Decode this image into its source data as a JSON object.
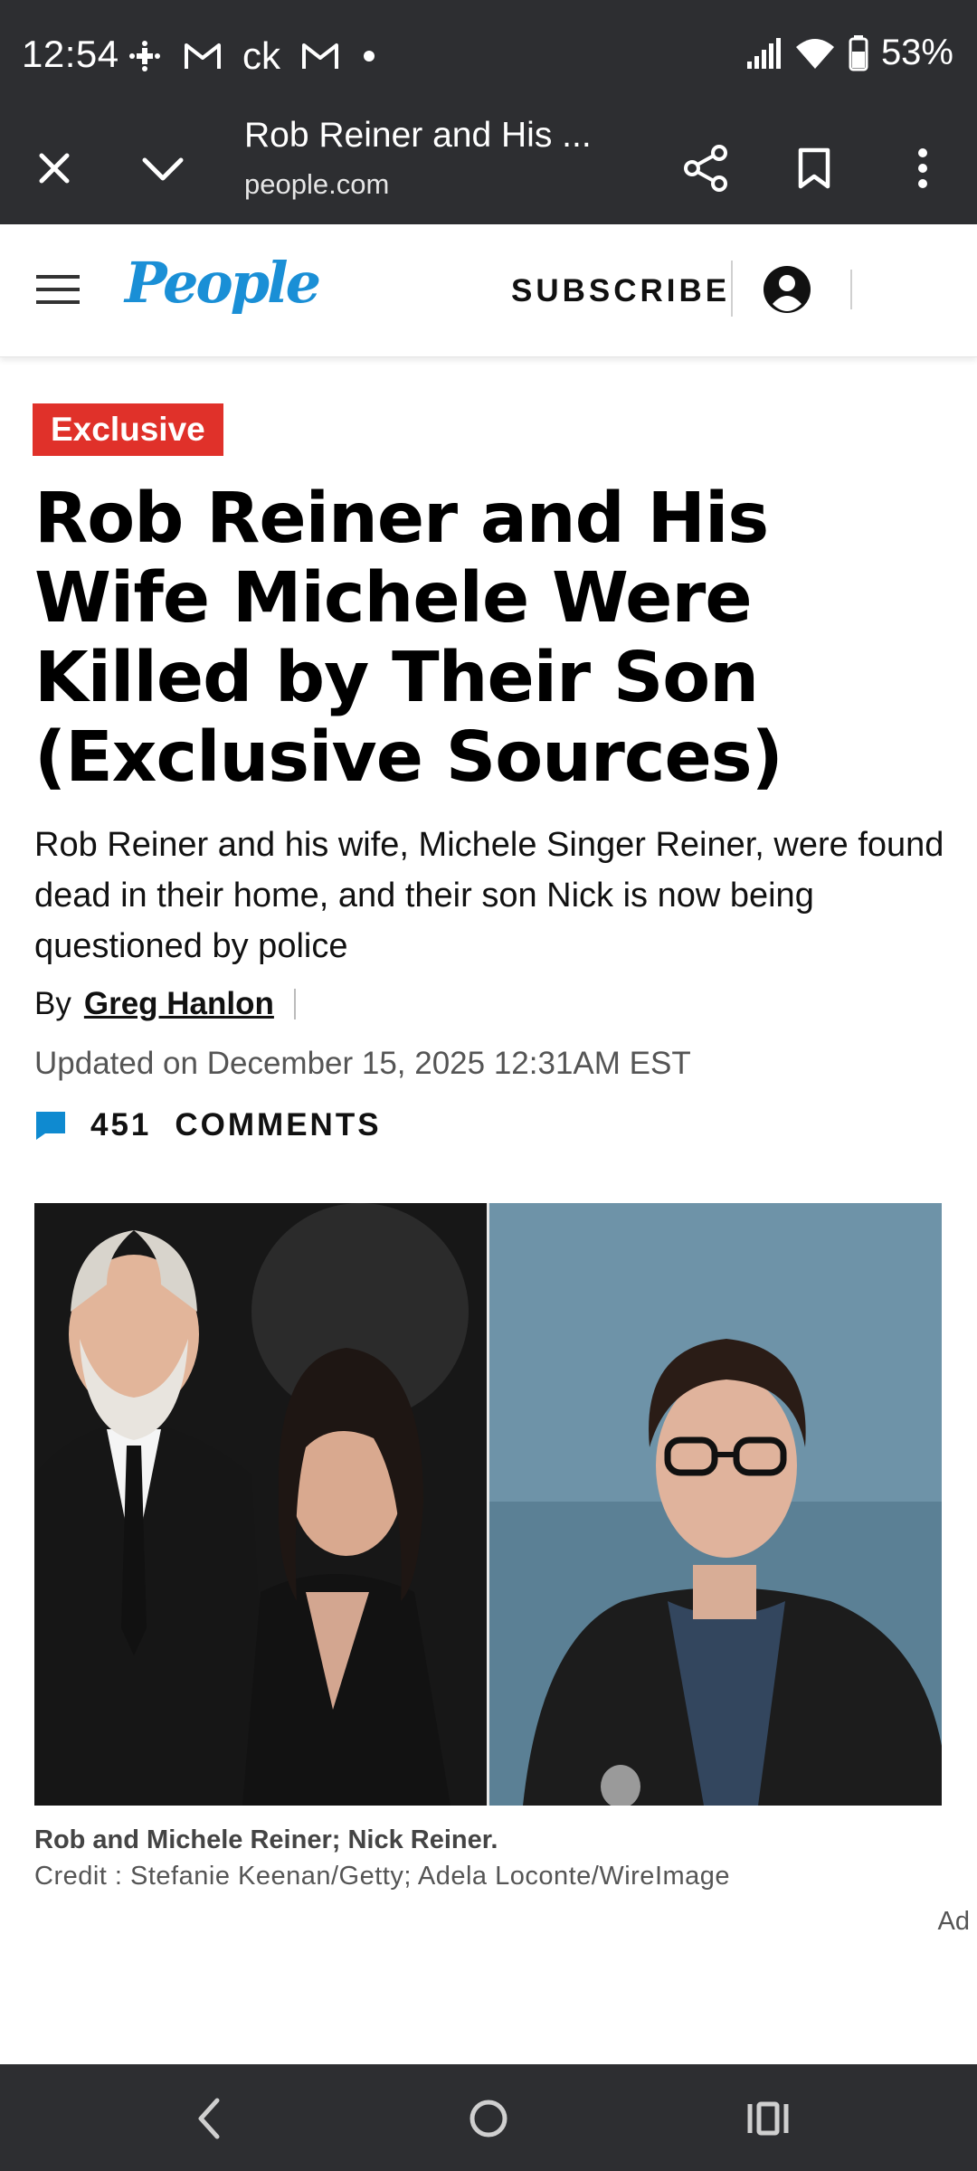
{
  "status_bar": {
    "time": "12:54",
    "notification_icons": [
      "slack-icon",
      "gmail-icon",
      "ck-icon",
      "gmail-icon",
      "dot-icon"
    ],
    "ck_text": "ck",
    "battery": "53%"
  },
  "browser": {
    "page_title": "Rob Reiner and His ...",
    "domain": "people.com"
  },
  "site": {
    "logo": "People",
    "subscribe": "SUBSCRIBE",
    "brand_color": "#1a8fd6"
  },
  "article": {
    "badge": "Exclusive",
    "badge_color": "#e0312a",
    "headline": "Rob Reiner and His Wife Michele Were Killed by Their Son (Exclusive Sources)",
    "dek": "Rob Reiner and his wife, Michele Singer Reiner, were found dead in their home, and their son Nick is now being questioned by police",
    "by_label": "By",
    "author": "Greg Hanlon",
    "updated": "Updated on December 15, 2025 12:31AM EST",
    "comments_count": "451",
    "comments_label": "COMMENTS",
    "caption": "Rob and Michele Reiner; Nick Reiner.",
    "credit": "Credit : Stefanie Keenan/Getty; Adela Loconte/WireImage",
    "ad_label": "Ad"
  }
}
